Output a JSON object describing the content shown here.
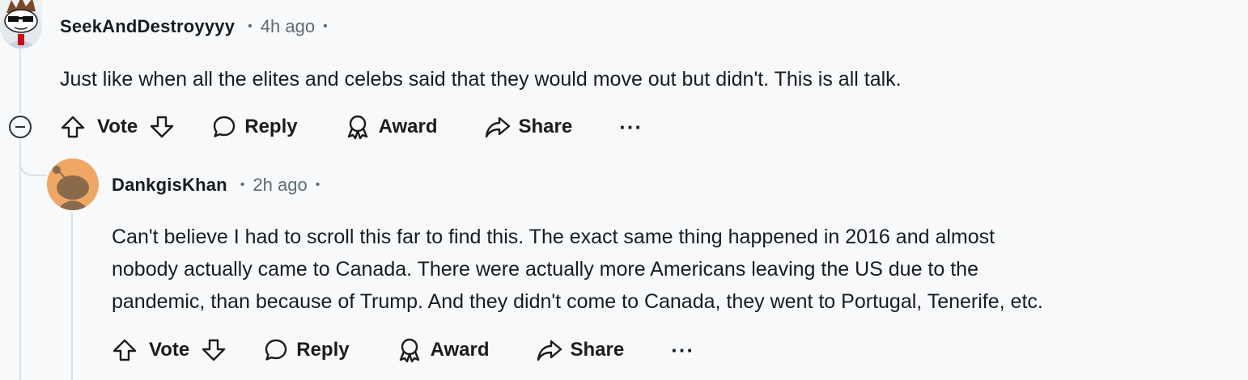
{
  "comments": [
    {
      "username": "SeekAndDestroyyyy",
      "dot_before": "•",
      "timestamp": "4h ago",
      "dot_after": "•",
      "body_lines": [
        "Just like when all the elites and celebs said that they would move out but didn't. This is all talk."
      ],
      "actions": {
        "vote": "Vote",
        "reply": "Reply",
        "award": "Award",
        "share": "Share",
        "more": "···"
      }
    },
    {
      "username": "DankgisKhan",
      "dot_before": "•",
      "timestamp": "2h ago",
      "dot_after": "•",
      "body_lines": [
        "Can't believe I had to scroll this far to find this. The exact same thing happened in 2016 and almost",
        "nobody actually came to Canada. There were actually more Americans leaving the US due to the",
        "pandemic, than because of Trump. And they didn't come to Canada, they went to Portugal, Tenerife, etc."
      ],
      "actions": {
        "vote": "Vote",
        "reply": "Reply",
        "award": "Award",
        "share": "Share",
        "more": "···"
      }
    }
  ],
  "icons": {
    "collapse": "collapse-minus-icon",
    "upvote": "upvote-arrow-icon",
    "downvote": "downvote-arrow-icon",
    "reply": "speech-bubble-icon",
    "award": "award-ribbon-icon",
    "share": "share-arrow-icon"
  },
  "colors": {
    "background": "#f7f9fb",
    "text": "#181c1f",
    "meta_text": "#5c6c74",
    "thread_line": "#dde1e5",
    "avatar2_bg": "#f0a766"
  }
}
